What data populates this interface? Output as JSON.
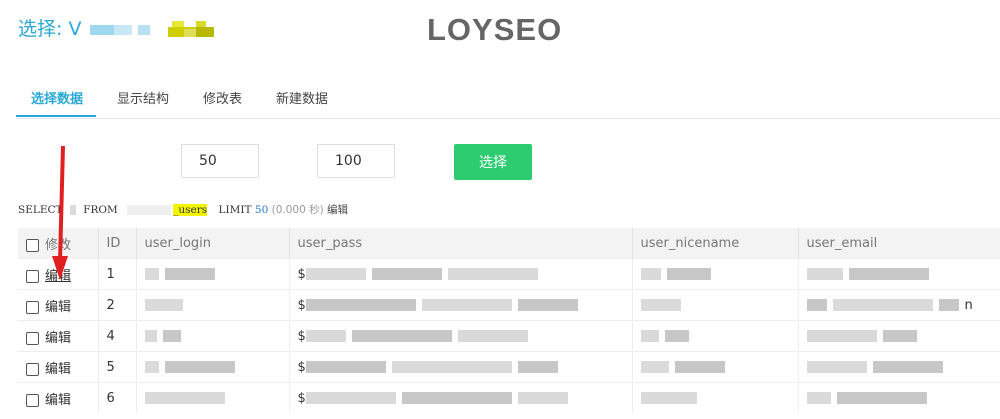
{
  "header": {
    "title": "选择: V",
    "logo": "LOYSEO"
  },
  "tabs": [
    {
      "label": "选择数据",
      "active": true
    },
    {
      "label": "显示结构",
      "active": false
    },
    {
      "label": "修改表",
      "active": false
    },
    {
      "label": "新建数据",
      "active": false
    }
  ],
  "paging": {
    "limit": "50",
    "offset": "100",
    "select_button": "选择"
  },
  "sql": {
    "select": "SELECT",
    "from": "FROM",
    "table_suffix": "_users",
    "limit_kw": "LIMIT",
    "limit_val": "50",
    "timing": "(0.000 秒)",
    "edit": "编辑"
  },
  "table": {
    "columns": [
      "修改",
      "ID",
      "user_login",
      "user_pass",
      "user_nicename",
      "user_email"
    ],
    "rows": [
      {
        "edit": "编辑",
        "id": "1",
        "pass_prefix": "$",
        "email_tail": ""
      },
      {
        "edit": "编辑",
        "id": "2",
        "pass_prefix": "$",
        "email_tail": "n"
      },
      {
        "edit": "编辑",
        "id": "4",
        "pass_prefix": "$",
        "email_tail": ""
      },
      {
        "edit": "编辑",
        "id": "5",
        "pass_prefix": "$",
        "email_tail": ""
      },
      {
        "edit": "编辑",
        "id": "6",
        "pass_prefix": "$",
        "email_tail": ""
      }
    ]
  },
  "colors": {
    "accent": "#2aa9d6",
    "button": "#2ecc71",
    "arrow": "#e02020",
    "highlight": "#f5f500"
  }
}
